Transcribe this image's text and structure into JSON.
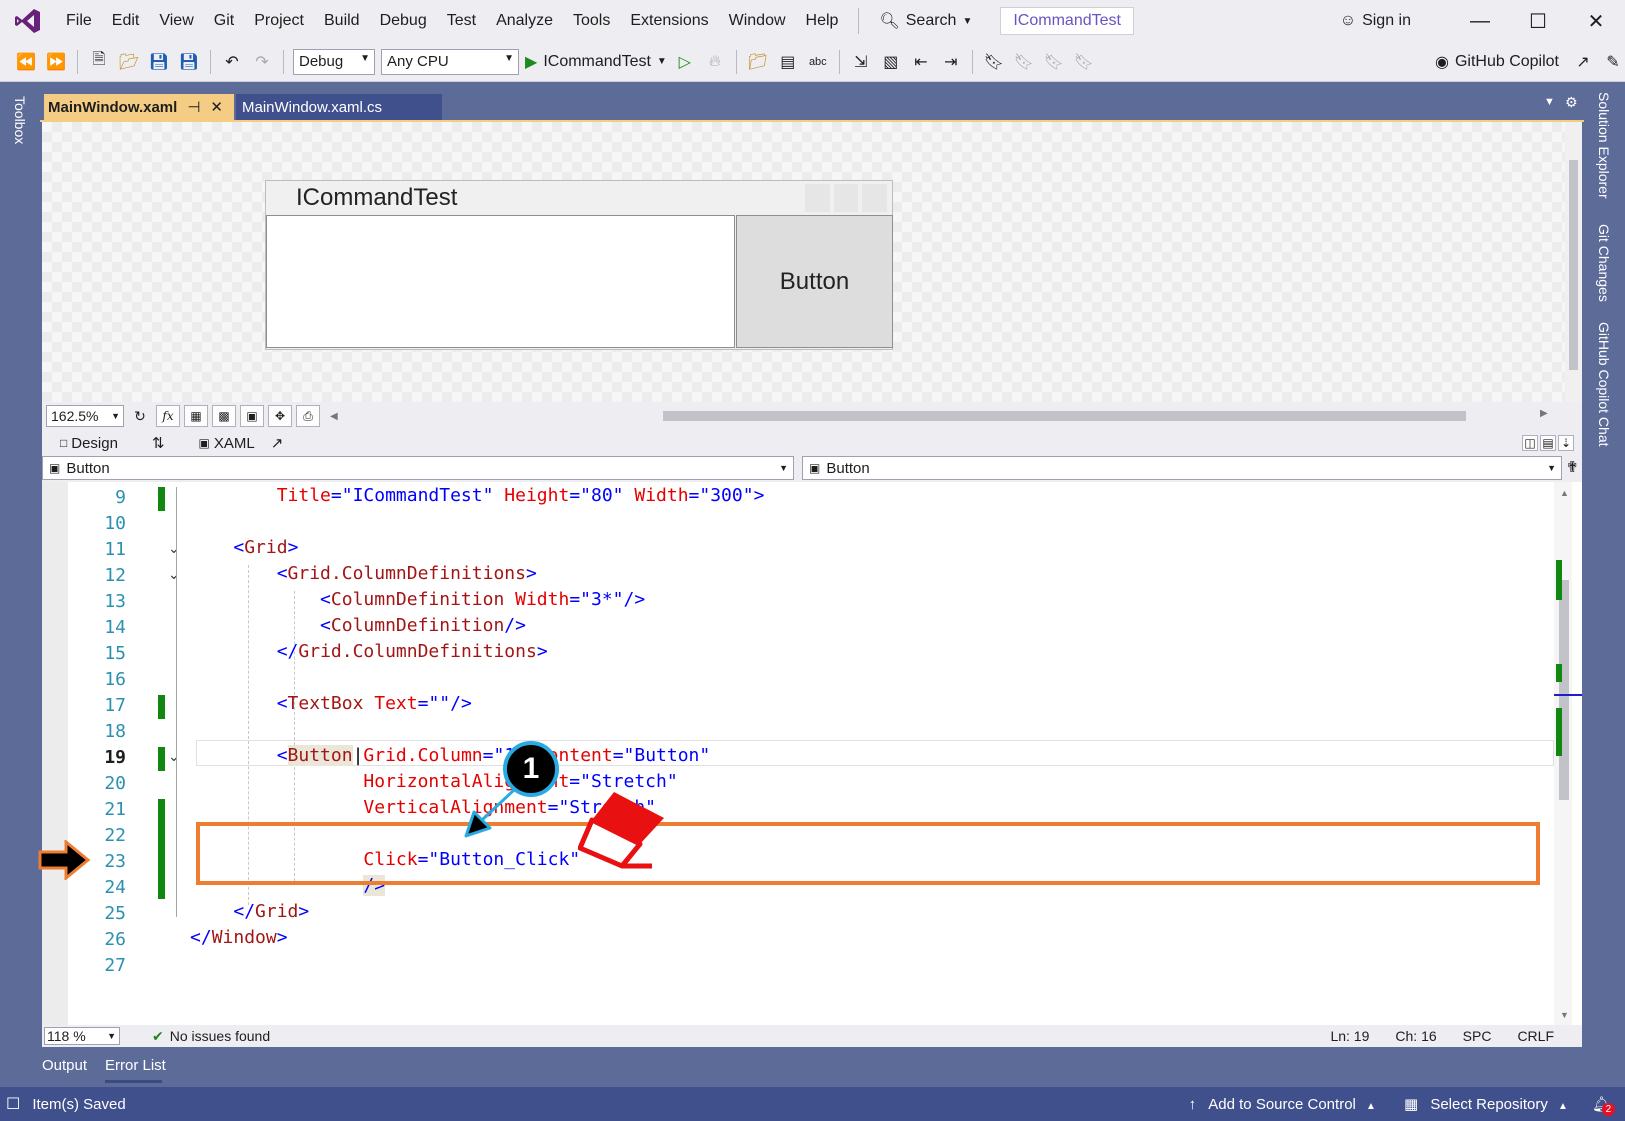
{
  "menu": {
    "items": [
      "File",
      "Edit",
      "View",
      "Git",
      "Project",
      "Build",
      "Debug",
      "Test",
      "Analyze",
      "Tools",
      "Extensions",
      "Window",
      "Help"
    ],
    "search_label": "Search",
    "title_badge": "ICommandTest",
    "sign_in": "Sign in"
  },
  "toolbar": {
    "configuration": "Debug",
    "platform": "Any CPU",
    "run_target": "ICommandTest",
    "copilot": "GitHub Copilot"
  },
  "side": {
    "toolbox": "Toolbox",
    "right_tabs": [
      "Solution Explorer",
      "Git Changes",
      "GitHub Copilot Chat"
    ]
  },
  "tabs": {
    "active": "MainWindow.xaml",
    "inactive": "MainWindow.xaml.cs"
  },
  "designer": {
    "window_title": "ICommandTest",
    "button_text": "Button",
    "zoom": "162.5%",
    "fx_label": "fx"
  },
  "view_switch": {
    "design": "Design",
    "xaml": "XAML"
  },
  "nav": {
    "left": "Button",
    "right": "Button"
  },
  "editor": {
    "line_numbers": [
      "9",
      "10",
      "11",
      "12",
      "13",
      "14",
      "15",
      "16",
      "17",
      "18",
      "19",
      "20",
      "21",
      "22",
      "23",
      "24",
      "25",
      "26",
      "27"
    ],
    "current_line": "19"
  },
  "editor_status": {
    "zoom": "118 %",
    "issues": "No issues found",
    "ln": "Ln: 19",
    "ch": "Ch: 16",
    "spc": "SPC",
    "crlf": "CRLF"
  },
  "annotation": {
    "badge": "1"
  },
  "bottom_tabs": [
    "Output",
    "Error List"
  ],
  "status": {
    "saved": "Item(s) Saved",
    "source_control": "Add to Source Control",
    "repository": "Select Repository",
    "notifications": "2"
  },
  "colors": {
    "frame": "#5d6b99",
    "chrome": "#eeeef2",
    "tab_active": "#f5cc84",
    "status_bar": "#40508d",
    "highlight": "#ed7d31",
    "keyword_blue": "#0000ff",
    "attribute_red": "#e50000"
  }
}
